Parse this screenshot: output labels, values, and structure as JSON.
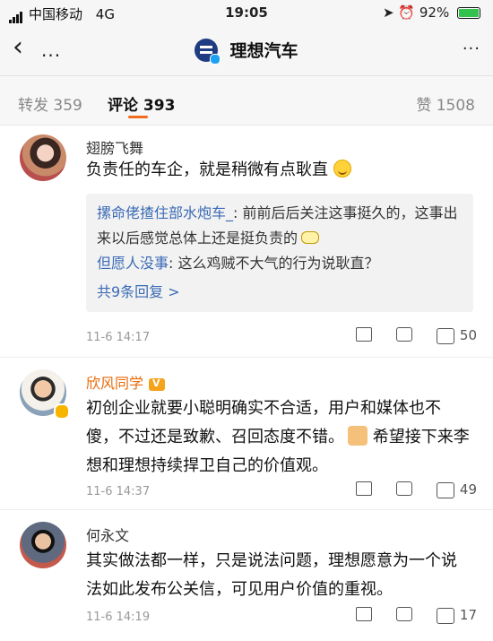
{
  "status_bar": {
    "carrier": "中国移动",
    "network": "4G",
    "time": "19:05",
    "battery": "92%",
    "battery_fill": 0.92,
    "colors": {
      "battery": "#33c24d"
    }
  },
  "nav": {
    "back_icon": "chevron-left-icon",
    "dots": "...",
    "title": "理想汽车",
    "more": "···"
  },
  "tabs": {
    "repost": "转发 359",
    "comments": "评论 393",
    "likes": "赞 1508",
    "accent_color": "#f36b1c"
  },
  "comments": [
    {
      "user": "翅膀飞舞",
      "text": "负责任的车企，就是稍微有点耿直",
      "replies": [
        {
          "name": "摞命佬揸住部水炮车_",
          "sep": ": ",
          "text": "前前后后关注这事挺久的，这事出来以后感觉总体上还是挺负责的"
        },
        {
          "name": "但愿人没事",
          "sep": ": ",
          "text": "这么鸡贼不大气的行为说耿直？"
        }
      ],
      "reply_count": "共9条回复 >",
      "date": "11-6 14:17",
      "likes": "50"
    },
    {
      "user": "欣风同学",
      "text_a": "初创企业就要小聪明确实不合适，用户和媒体也不傻，不过还是致歉、召回态度不错。",
      "text_b": " 希望接下来李想和理想持续捍卫自己的价值观。",
      "date": "11-6 14:37",
      "likes": "49"
    },
    {
      "user": "何永文",
      "text": "其实做法都一样，只是说法问题，理想愿意为一个说法如此发布公关信，可见用户价值的重视。",
      "date": "11-6 14:19",
      "likes": "17"
    }
  ]
}
